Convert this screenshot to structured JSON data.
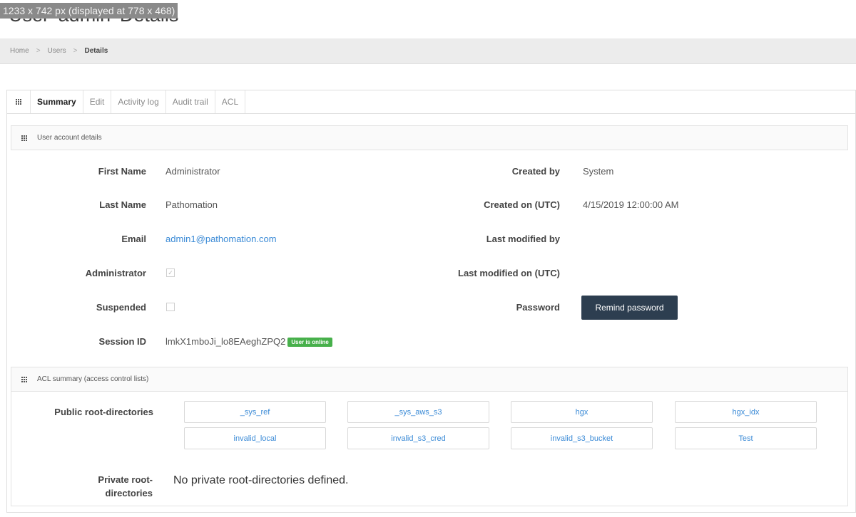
{
  "image_note": "1233 x 742 px (displayed at 778 x 468)",
  "page_title": "User 'admin' Details",
  "breadcrumb": [
    "Home",
    "Users",
    "Details"
  ],
  "tabs": [
    "Summary",
    "Edit",
    "Activity log",
    "Audit trail",
    "ACL"
  ],
  "active_tab": "Summary",
  "account_section": {
    "title": "User account details",
    "fields": {
      "first_name_label": "First Name",
      "first_name": "Administrator",
      "last_name_label": "Last Name",
      "last_name": "Pathomation",
      "email_label": "Email",
      "email": "admin1@pathomation.com",
      "administrator_label": "Administrator",
      "administrator_checked": true,
      "suspended_label": "Suspended",
      "suspended_checked": false,
      "session_label": "Session ID",
      "session_id": "lmkX1mboJi_lo8EAeghZPQ2",
      "online_badge": "User is online",
      "created_by_label": "Created by",
      "created_by": "System",
      "created_on_label": "Created on (UTC)",
      "created_on": "4/15/2019 12:00:00 AM",
      "modified_by_label": "Last modified by",
      "modified_on_label": "Last modified on (UTC)",
      "password_label": "Password",
      "remind_button": "Remind password"
    }
  },
  "acl_section": {
    "title": "ACL summary (access control lists)",
    "public_label": "Public root-directories",
    "public_dirs": [
      "_sys_ref",
      "_sys_aws_s3",
      "hgx",
      "hgx_idx",
      "invalid_local",
      "invalid_s3_cred",
      "invalid_s3_bucket",
      "Test"
    ],
    "private_label": "Private root-directories",
    "private_message": "No private root-directories defined."
  },
  "colors": {
    "accent_dark": "#2d3e50",
    "link": "#3a8ad6",
    "online_badge": "#47b04b"
  }
}
